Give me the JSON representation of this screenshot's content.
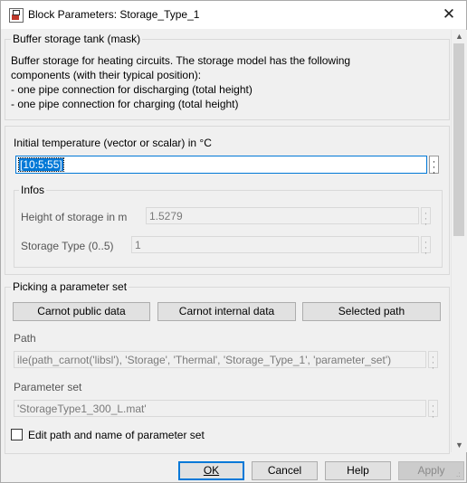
{
  "window": {
    "title": "Block Parameters: Storage_Type_1",
    "close_glyph": "✕"
  },
  "mask": {
    "legend": "Buffer storage tank (mask)",
    "description_lines": [
      "Buffer storage for heating circuits. The storage model has the following",
      "components (with their typical position):",
      "- one pipe connection for discharging (total height)",
      "- one pipe connection for charging (total height)"
    ]
  },
  "params": {
    "initial_temp_label": "Initial temperature (vector or scalar) in °C",
    "initial_temp_value": "[10:5:55]",
    "infos": {
      "legend": "Infos",
      "height_label": "Height of storage in m",
      "height_value": "1.5279",
      "type_label": "Storage Type (0..5)",
      "type_value": "1"
    }
  },
  "picking": {
    "legend": "Picking a parameter set",
    "buttons": [
      "Carnot public data",
      "Carnot internal data",
      "Selected path"
    ],
    "path_label": "Path",
    "path_value": "ile(path_carnot('libsl'), 'Storage', 'Thermal', 'Storage_Type_1', 'parameter_set')",
    "parameter_set_label": "Parameter set",
    "parameter_set_value": "'StorageType1_300_L.mat'",
    "edit_checkbox_label": "Edit path and name of parameter set",
    "edit_checked": false
  },
  "footer": {
    "ok": "OK",
    "cancel": "Cancel",
    "help": "Help",
    "apply": "Apply"
  },
  "icons": {
    "app": "simulink-block-icon",
    "close": "close-icon",
    "more": "ellipsis-vertical-icon",
    "scroll_up": "▲",
    "scroll_down": "▼"
  }
}
